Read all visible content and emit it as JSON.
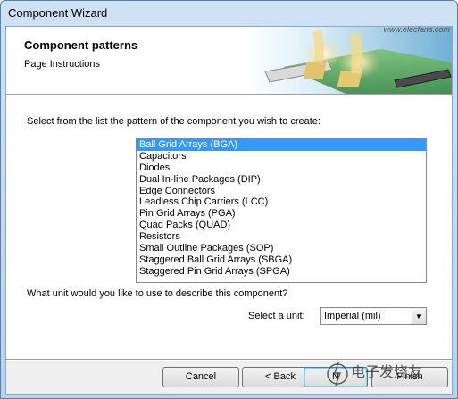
{
  "window": {
    "title": "Component Wizard"
  },
  "header": {
    "title": "Component patterns",
    "subtitle": "Page Instructions"
  },
  "content": {
    "prompt": "Select from the list the pattern of the component you wish to create:",
    "patterns": [
      "Ball Grid Arrays (BGA)",
      "Capacitors",
      "Diodes",
      "Dual In-line Packages (DIP)",
      "Edge Connectors",
      "Leadless Chip Carriers (LCC)",
      "Pin Grid Arrays (PGA)",
      "Quad Packs (QUAD)",
      "Resistors",
      "Small Outline Packages (SOP)",
      "Staggered Ball Grid Arrays (SBGA)",
      "Staggered Pin Grid Arrays (SPGA)"
    ],
    "selected_pattern": "Ball Grid Arrays (BGA)",
    "unit_question": "What unit would you like to use to describe this component?",
    "unit_label": "Select a unit:",
    "unit_value": "Imperial (mil)"
  },
  "buttons": {
    "cancel": "Cancel",
    "back": "< Back",
    "next": "N",
    "finish": "Finish"
  },
  "watermark": {
    "text": "电子发烧友",
    "domain": "www.elecfans.com"
  }
}
